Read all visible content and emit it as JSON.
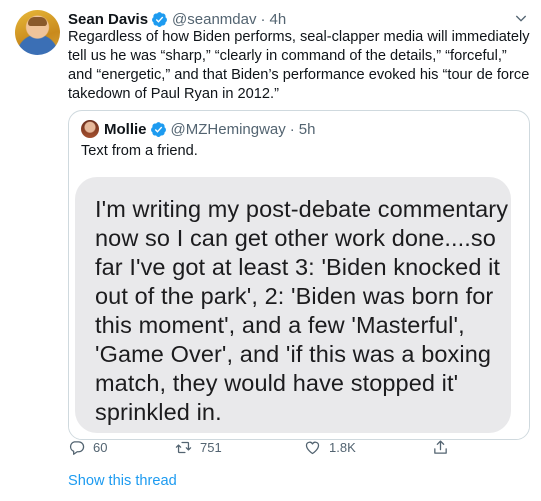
{
  "tweet": {
    "author_name": "Sean Davis",
    "author_handle": "@seanmdav",
    "separator": "·",
    "time": "4h",
    "text": "Regardless of how Biden performs, seal-clapper media will immediately tell us he was “sharp,” “clearly in command of the details,” “forceful,” and “energetic,” and that Biden’s performance evoked his “tour de force takedown of Paul Ryan in 2012.”"
  },
  "quote": {
    "author_name": "Mollie",
    "author_handle": "@MZHemingway",
    "separator": "·",
    "time": "5h",
    "text": "Text from a friend.",
    "image_text": "I'm writing my post-debate commentary now so I can get other work  done....so far I've got at least 3: 'Biden knocked it out of the park', 2: 'Biden was born for this moment', and a few 'Masterful', 'Game Over', and 'if this was a boxing match, they would have stopped it' sprinkled in."
  },
  "actions": {
    "reply_count": "60",
    "retweet_count": "751",
    "like_count": "1.8K"
  },
  "thread_link": "Show this thread",
  "colors": {
    "accent": "#1d9bf0",
    "secondary_text": "#536471",
    "border": "#cfd9de",
    "bubble": "#e9e9eb"
  },
  "icons": {
    "verified": "verified-badge-icon",
    "more": "chevron-down-icon",
    "reply": "reply-icon",
    "retweet": "retweet-icon",
    "like": "heart-icon",
    "share": "share-icon"
  }
}
